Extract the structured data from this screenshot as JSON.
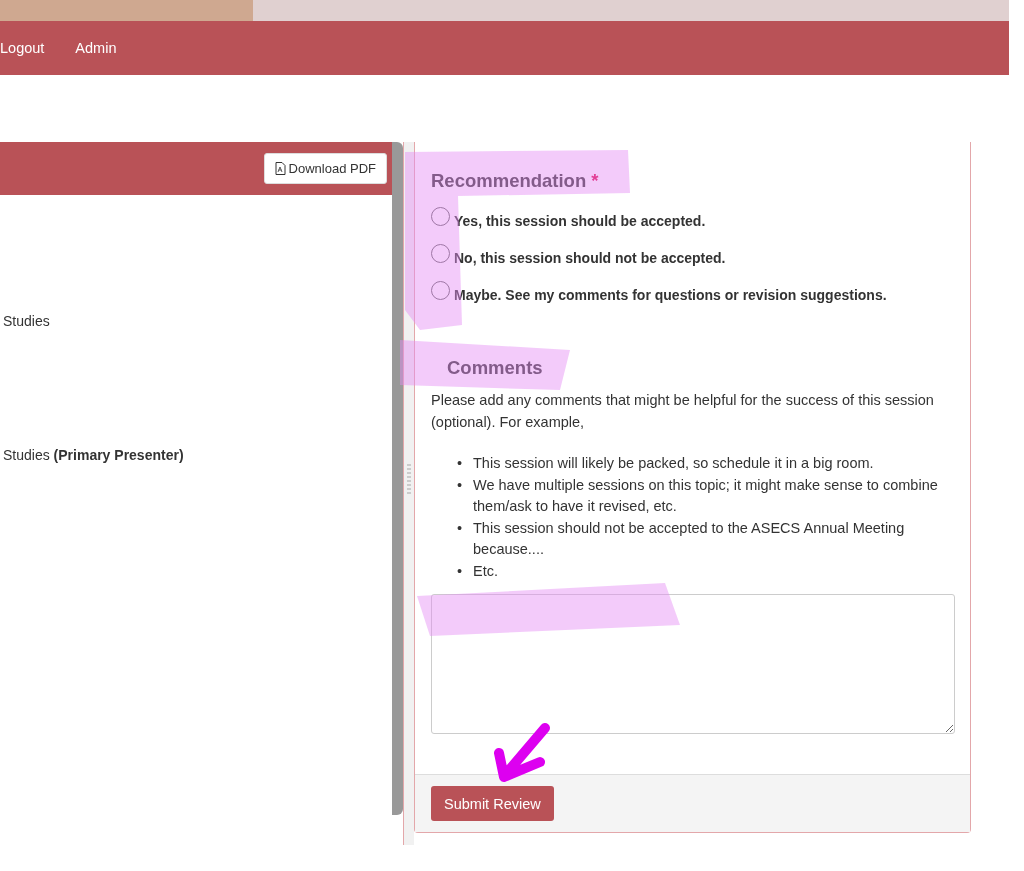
{
  "nav": {
    "links": [
      {
        "label": "Logout"
      },
      {
        "label": "Admin"
      }
    ]
  },
  "left_panel": {
    "download_button": "Download PDF",
    "lines": [
      {
        "text": "Studies"
      },
      {
        "text": "Studies **(Primary Presenter)**"
      }
    ]
  },
  "review": {
    "recommendation": {
      "title": "Recommendation",
      "required_mark": "*",
      "options": [
        {
          "label": "Yes, this session should be accepted.",
          "selected": false
        },
        {
          "label": "No, this session should not be accepted.",
          "selected": false
        },
        {
          "label": "Maybe. See my comments for questions or revision suggestions.",
          "selected": false
        }
      ]
    },
    "comments": {
      "title": "Comments",
      "bullet_marker": "•",
      "intro": "Please add any comments that might be helpful for the success of this session (optional). For example,",
      "bullets": [
        "This session will likely be packed, so schedule it in a big room.",
        "We have multiple sessions on this topic; it might make sense to combine them/ask to have it revised, etc.",
        "This session should not be accepted to the ASECS Annual Meeting because....",
        "Etc."
      ]
    },
    "submit_button": "Submit Review"
  }
}
